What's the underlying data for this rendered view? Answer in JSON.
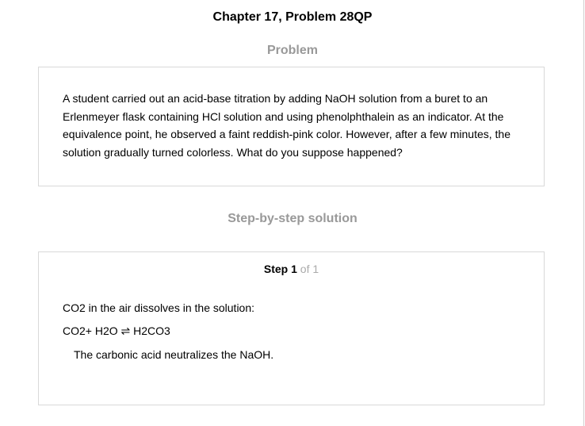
{
  "header": {
    "title": "Chapter 17, Problem 28QP"
  },
  "problem": {
    "heading": "Problem",
    "text": "A student carried out an acid-base titration by adding NaOH solution from a buret to an Erlenmeyer flask containing HCl solution and using phenolphthalein as an indicator. At the equivalence point, he observed a faint reddish-pink color. However, after a few minutes, the solution gradually turned colorless. What do you suppose happened?"
  },
  "solution": {
    "heading": "Step-by-step solution",
    "step": {
      "word": "Step",
      "number": "1",
      "of": "of 1"
    },
    "lines": [
      "CO2 in the air dissolves in the solution:",
      "CO2+ H2O ⇌ H2CO3",
      "The carbonic acid neutralizes the NaOH."
    ]
  }
}
